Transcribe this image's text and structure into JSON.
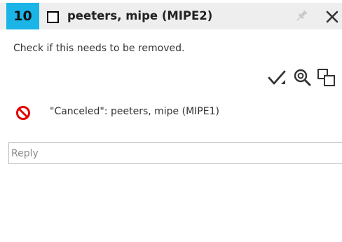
{
  "header": {
    "number": "10",
    "title": "peeters, mipe (MIPE2)"
  },
  "message": "Check if this needs to be removed.",
  "actions": {
    "icons": [
      "checkmark-icon",
      "zoom-icon",
      "copy-icon"
    ]
  },
  "status": {
    "icon": "no-entry-icon",
    "text": "\"Canceled\": peeters, mipe (MIPE1)",
    "color": "#e00000"
  },
  "reply": {
    "placeholder": "Reply",
    "value": ""
  },
  "colors": {
    "badge": "#1ab4e6",
    "header_bg": "#eeeeee"
  }
}
